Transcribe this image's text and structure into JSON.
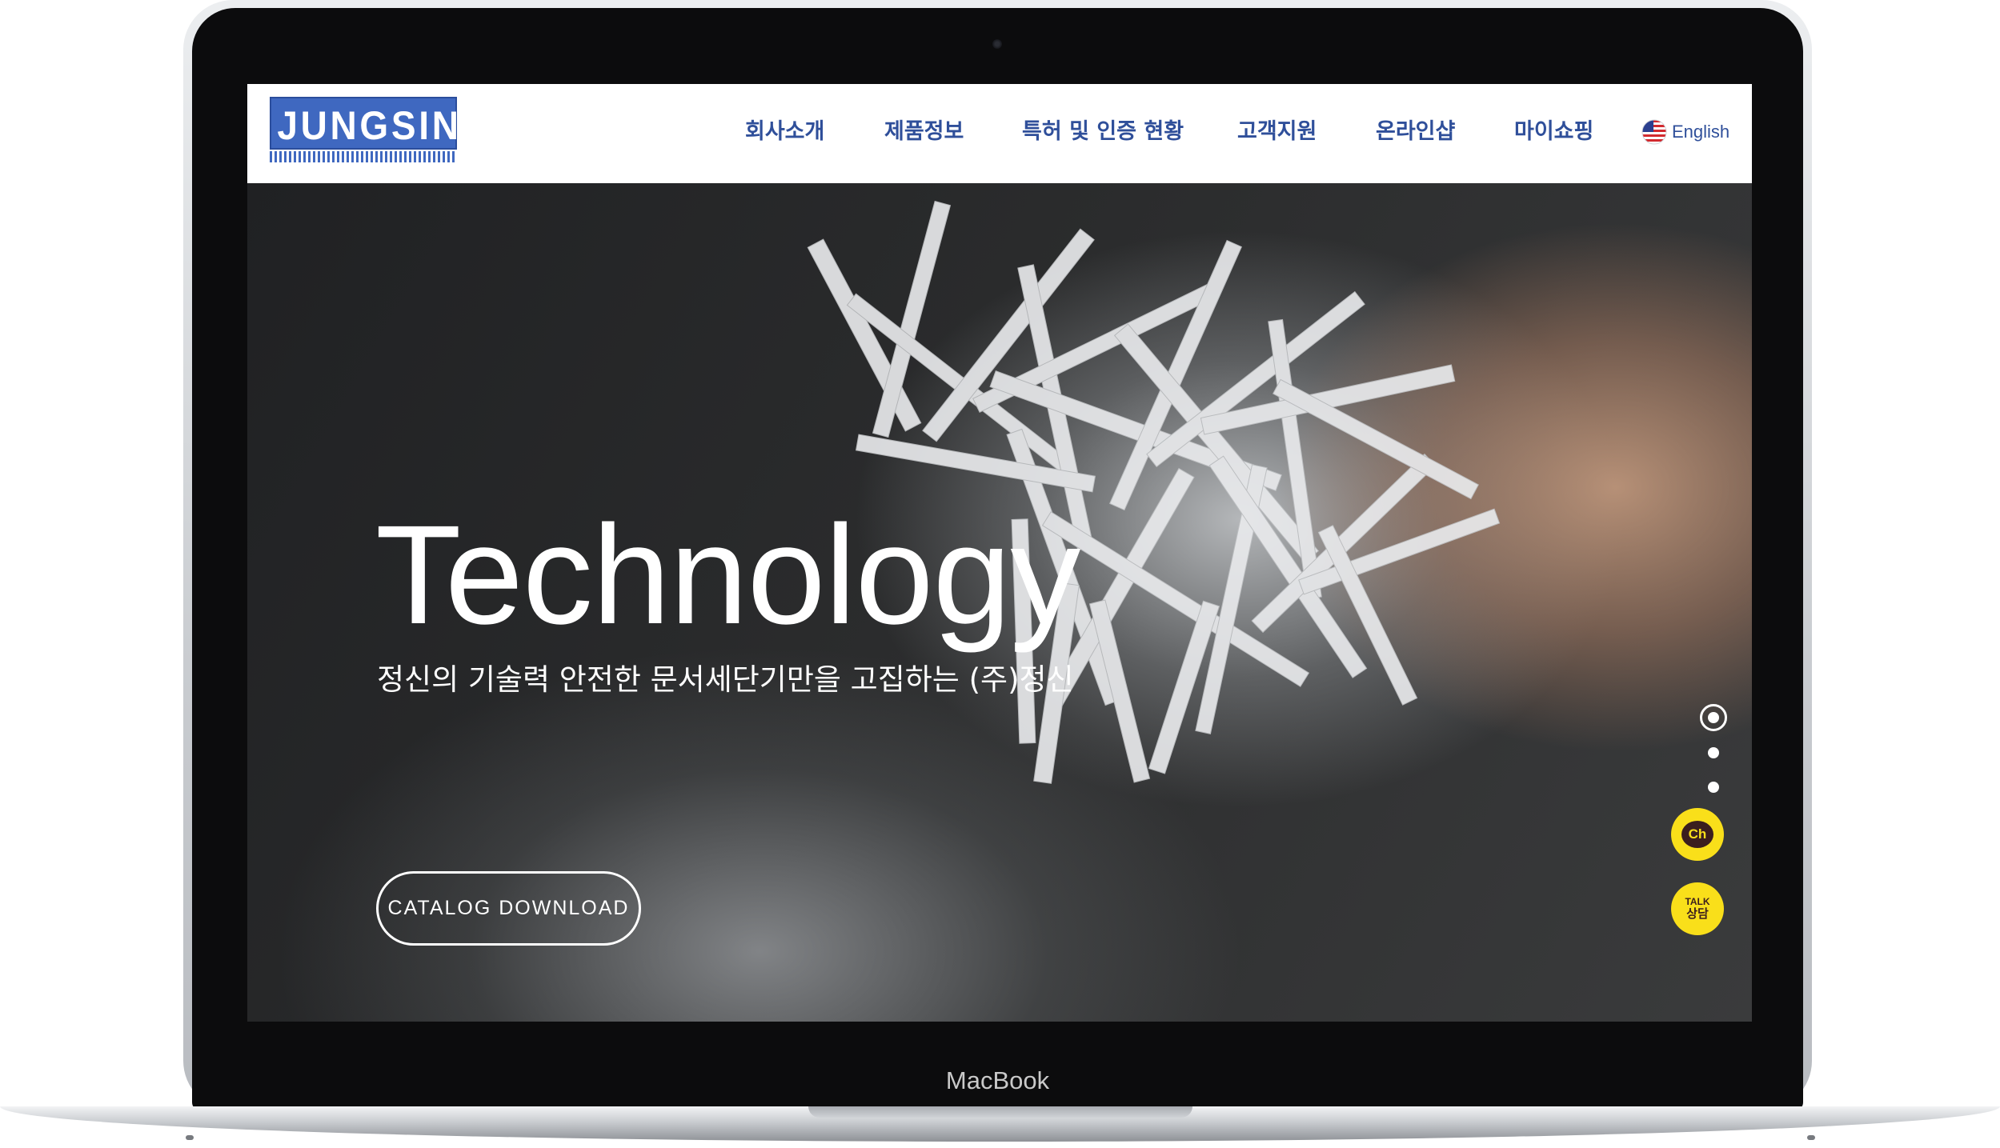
{
  "device": {
    "label": "MacBook"
  },
  "site": {
    "logo_text": "JUNGSIN",
    "nav": [
      {
        "label": "회사소개"
      },
      {
        "label": "제품정보"
      },
      {
        "label": "특허 및 인증 현황"
      },
      {
        "label": "고객지원"
      },
      {
        "label": "온라인샵"
      },
      {
        "label": "마이쇼핑"
      }
    ],
    "language": {
      "label": "English",
      "icon": "us-flag-icon"
    },
    "colors": {
      "nav_text": "#2f4f9a",
      "logo_blue": "#3f68c0",
      "kakao_yellow": "#f9df1a"
    }
  },
  "hero": {
    "title": "Technology",
    "subtitle": "정신의 기술력 안전한 문서세단기만을 고집하는 (주)정신",
    "cta_label": "CATALOG DOWNLOAD",
    "slides": {
      "count": 3,
      "active": 1
    }
  },
  "floating": {
    "kakao_channel_label": "Ch",
    "kakao_talk_label_1": "TALK",
    "kakao_talk_label_2": "상담"
  }
}
